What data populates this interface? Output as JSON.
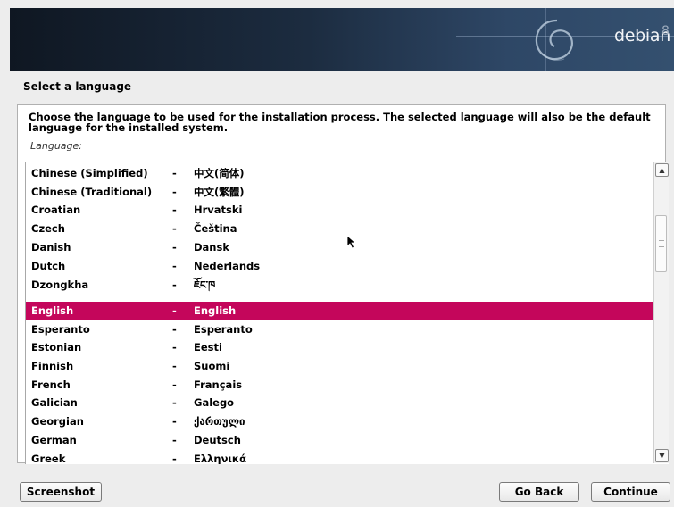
{
  "banner": {
    "brand": "debian",
    "version": "8"
  },
  "step_title": "Select a language",
  "description": "Choose the language to be used for the installation process. The selected language will also be the default language for the installed system.",
  "list_label": "Language:",
  "languages": [
    {
      "name": "Chinese (Simplified)",
      "sep": "-",
      "native": "中文(简体)"
    },
    {
      "name": "Chinese (Traditional)",
      "sep": "-",
      "native": "中文(繁體)"
    },
    {
      "name": "Croatian",
      "sep": "-",
      "native": "Hrvatski"
    },
    {
      "name": "Czech",
      "sep": "-",
      "native": "Čeština"
    },
    {
      "name": "Danish",
      "sep": "-",
      "native": "Dansk"
    },
    {
      "name": "Dutch",
      "sep": "-",
      "native": "Nederlands"
    },
    {
      "name": "Dzongkha",
      "sep": "-",
      "native": "ཇོང་ཁ"
    },
    {
      "name": "English",
      "sep": "-",
      "native": "English"
    },
    {
      "name": "Esperanto",
      "sep": "-",
      "native": "Esperanto"
    },
    {
      "name": "Estonian",
      "sep": "-",
      "native": "Eesti"
    },
    {
      "name": "Finnish",
      "sep": "-",
      "native": "Suomi"
    },
    {
      "name": "French",
      "sep": "-",
      "native": "Français"
    },
    {
      "name": "Galician",
      "sep": "-",
      "native": "Galego"
    },
    {
      "name": "Georgian",
      "sep": "-",
      "native": "ქართული"
    },
    {
      "name": "German",
      "sep": "-",
      "native": "Deutsch"
    },
    {
      "name": "Greek",
      "sep": "-",
      "native": "Ελληνικά"
    }
  ],
  "selected_language": "English",
  "colors": {
    "selection": "#c4065b",
    "banner_dark": "#0f1722",
    "banner_light": "#34506f"
  },
  "buttons": {
    "screenshot": "Screenshot",
    "go_back": "Go Back",
    "continue": "Continue"
  }
}
